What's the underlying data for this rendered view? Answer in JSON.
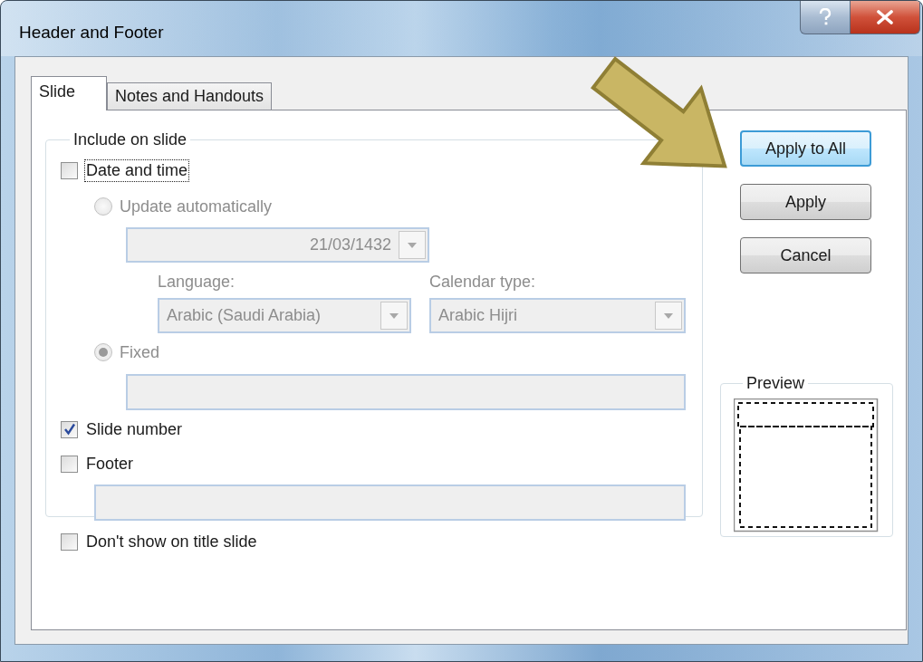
{
  "window": {
    "title": "Header and Footer"
  },
  "tabs": [
    {
      "label": "Slide",
      "selected": true
    },
    {
      "label": "Notes and Handouts",
      "selected": false
    }
  ],
  "include_group": {
    "title": "Include on slide",
    "date_and_time": {
      "label": "Date and time",
      "checked": false,
      "focused": true
    },
    "update_automatically": {
      "label": "Update automatically",
      "selected": false,
      "disabled": true
    },
    "date_format": {
      "value": "21/03/1432",
      "disabled": true
    },
    "language": {
      "label": "Language:",
      "value": "Arabic (Saudi Arabia)",
      "disabled": true
    },
    "calendar_type": {
      "label": "Calendar type:",
      "value": "Arabic Hijri",
      "disabled": true
    },
    "fixed": {
      "label": "Fixed",
      "selected": true,
      "disabled": true
    },
    "fixed_field": {
      "disabled": true
    },
    "slide_number": {
      "label": "Slide number",
      "checked": true
    },
    "footer": {
      "label": "Footer",
      "checked": false
    },
    "footer_field": {
      "disabled": true
    }
  },
  "dont_show_on_title_slide": {
    "label": "Don't show on title slide",
    "checked": false
  },
  "buttons": [
    {
      "label": "Apply to All",
      "default": true
    },
    {
      "label": "Apply",
      "default": false
    },
    {
      "label": "Cancel",
      "default": false
    }
  ],
  "preview": {
    "title": "Preview"
  }
}
